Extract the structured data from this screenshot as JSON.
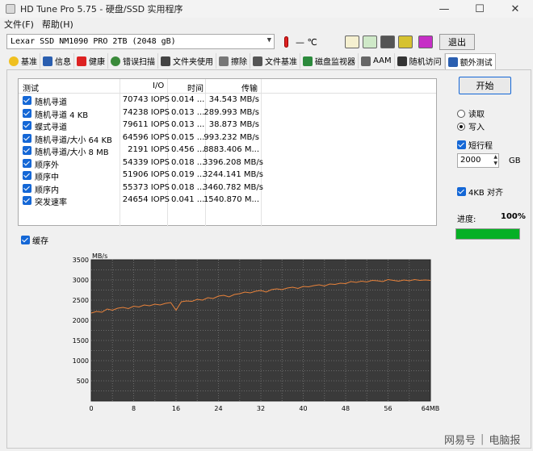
{
  "window": {
    "title": "HD Tune Pro 5.75 - 硬盘/SSD 实用程序",
    "min_icon": "minimize-icon",
    "max_icon": "maximize-icon",
    "close_icon": "close-icon"
  },
  "menu": [
    "文件(F)",
    "帮助(H)"
  ],
  "toolbar": {
    "drive": "Lexar SSD NM1090 PRO 2TB (2048 gB)",
    "temperature": "— ℃",
    "exit_label": "退出"
  },
  "tabs": [
    {
      "label": "基准",
      "icon": "bulb-icon"
    },
    {
      "label": "信息",
      "icon": "info-icon"
    },
    {
      "label": "健康",
      "icon": "health-cross-icon"
    },
    {
      "label": "错误扫描",
      "icon": "magnifier-icon"
    },
    {
      "label": "文件夹使用",
      "icon": "folder-icon"
    },
    {
      "label": "擦除",
      "icon": "trash-icon"
    },
    {
      "label": "文件基准",
      "icon": "file-icon"
    },
    {
      "label": "磁盘监视器",
      "icon": "monitor-icon"
    },
    {
      "label": "AAM",
      "icon": "speaker-icon"
    },
    {
      "label": "随机访问",
      "icon": "random-icon"
    },
    {
      "label": "额外测试",
      "icon": "extra-test-icon"
    }
  ],
  "results": {
    "headers": {
      "test": "测试",
      "io": "I/O",
      "time": "时间",
      "throughput": "传输"
    },
    "rows": [
      {
        "name": "随机寻道",
        "io": "70743 IOPS",
        "time": "0.014 ...",
        "throughput": "34.543 MB/s"
      },
      {
        "name": "随机寻道 4 KB",
        "io": "74238 IOPS",
        "time": "0.013 ...",
        "throughput": "289.993 MB/s"
      },
      {
        "name": "蝶式寻道",
        "io": "79611 IOPS",
        "time": "0.013 ...",
        "throughput": "38.873 MB/s"
      },
      {
        "name": "随机寻道/大小 64 KB",
        "io": "64596 IOPS",
        "time": "0.015 ...",
        "throughput": "993.232 MB/s"
      },
      {
        "name": "随机寻道/大小 8 MB",
        "io": "2191 IOPS",
        "time": "0.456 ...",
        "throughput": "8883.406 M..."
      },
      {
        "name": "顺序外",
        "io": "54339 IOPS",
        "time": "0.018 ...",
        "throughput": "3396.208 MB/s"
      },
      {
        "name": "顺序中",
        "io": "51906 IOPS",
        "time": "0.019 ...",
        "throughput": "3244.141 MB/s"
      },
      {
        "name": "顺序内",
        "io": "55373 IOPS",
        "time": "0.018 ...",
        "throughput": "3460.782 MB/s"
      },
      {
        "name": "突发速率",
        "io": "24654 IOPS",
        "time": "0.041 ...",
        "throughput": "1540.870 M..."
      }
    ]
  },
  "cache_label": "缓存",
  "controls": {
    "start_label": "开始",
    "read_label": "读取",
    "write_label": "写入",
    "short_stroke_label": "短行程",
    "short_stroke_value": "2000",
    "unit_label": "GB",
    "align_label": "4KB 对齐",
    "progress_label": "进度:",
    "progress_value": "100%",
    "progress_fraction": 1.0
  },
  "chart_data": {
    "type": "line",
    "ylabel": "MB/s",
    "xlabel": "",
    "ylim": [
      0,
      3500
    ],
    "xlim": [
      0,
      64
    ],
    "yticks": [
      "3500",
      "3000",
      "2500",
      "2000",
      "1500",
      "1000",
      "500"
    ],
    "xticks": [
      "0",
      "8",
      "16",
      "24",
      "32",
      "40",
      "48",
      "56",
      "64MB"
    ],
    "grid": true,
    "series": [
      {
        "color": "#e8823a",
        "x": [
          0,
          1,
          2,
          3,
          4,
          5,
          6,
          7,
          8,
          9,
          10,
          11,
          12,
          13,
          14,
          15,
          16,
          17,
          18,
          19,
          20,
          21,
          22,
          23,
          24,
          25,
          26,
          27,
          28,
          29,
          30,
          31,
          32,
          33,
          34,
          35,
          36,
          37,
          38,
          39,
          40,
          41,
          42,
          43,
          44,
          45,
          46,
          47,
          48,
          49,
          50,
          51,
          52,
          53,
          54,
          55,
          56,
          57,
          58,
          59,
          60,
          61,
          62,
          63,
          64
        ],
        "y": [
          2180,
          2220,
          2200,
          2280,
          2250,
          2300,
          2320,
          2290,
          2350,
          2330,
          2380,
          2360,
          2400,
          2380,
          2420,
          2440,
          2250,
          2460,
          2480,
          2470,
          2520,
          2500,
          2560,
          2540,
          2600,
          2620,
          2580,
          2640,
          2660,
          2700,
          2680,
          2720,
          2740,
          2700,
          2760,
          2780,
          2760,
          2800,
          2820,
          2790,
          2840,
          2830,
          2860,
          2880,
          2850,
          2900,
          2890,
          2920,
          2910,
          2960,
          2940,
          2970,
          2950,
          2990,
          2980,
          2960,
          3010,
          2990,
          2970,
          3000,
          2980,
          3010,
          2990,
          3000,
          2990
        ]
      }
    ]
  },
  "watermark": {
    "left": "网易号",
    "right": "电脑报"
  }
}
